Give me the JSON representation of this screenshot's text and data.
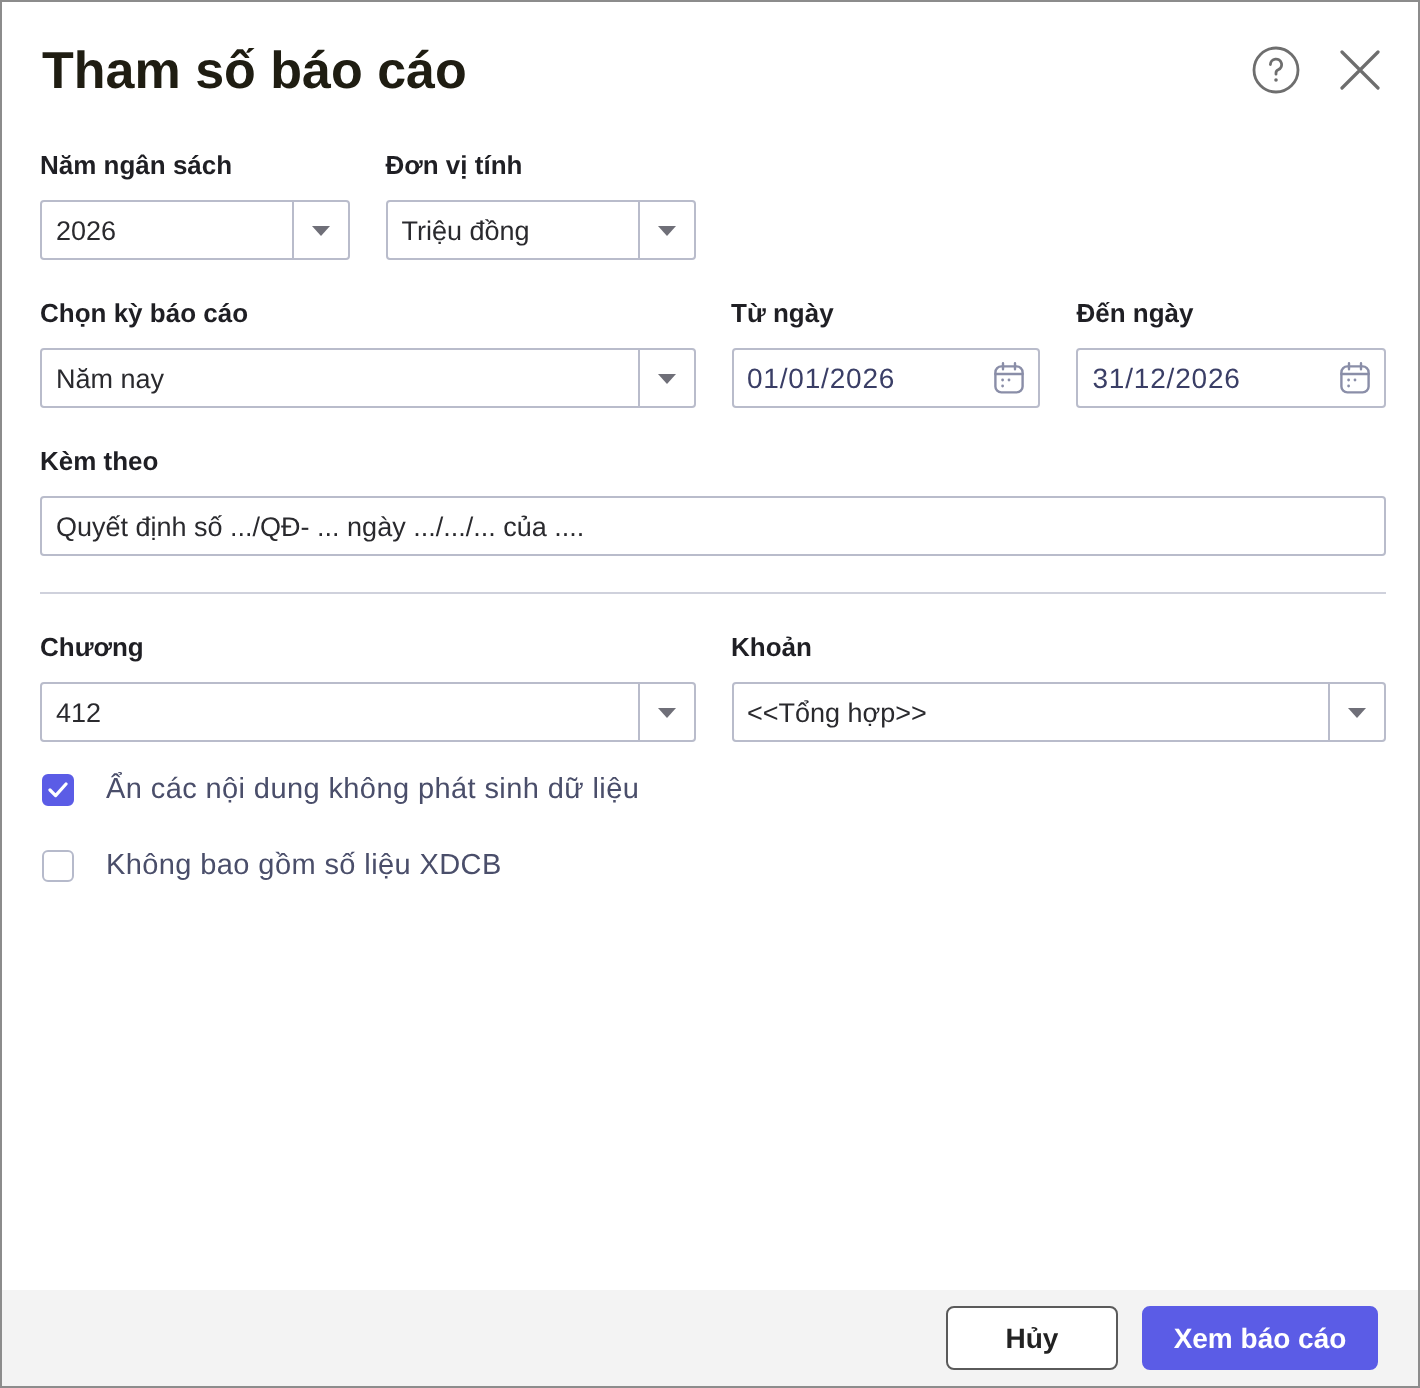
{
  "dialog": {
    "title": "Tham số báo cáo"
  },
  "form": {
    "sections": [
      {
        "rows": [
          [
            {
              "kind": "select",
              "label": "Năm ngân sách",
              "value": "2026"
            },
            {
              "kind": "select",
              "label": "Đơn vị tính",
              "value": "Triệu đồng"
            }
          ],
          [
            {
              "kind": "select",
              "label": "Chọn kỳ báo cáo",
              "value": "Năm nay"
            },
            {
              "kind": "date",
              "label": "Từ ngày",
              "value": "01/01/2026"
            },
            {
              "kind": "date",
              "label": "Đến ngày",
              "value": "31/12/2026"
            }
          ],
          [
            {
              "kind": "text",
              "label": "Kèm theo",
              "value": "Quyết định số .../QĐ- ... ngày .../.../... của ...."
            }
          ]
        ]
      },
      {
        "rows": [
          [
            {
              "kind": "select",
              "label": "Chương",
              "value": "412"
            },
            {
              "kind": "select",
              "label": "Khoản",
              "value": "<<Tổng hợp>>"
            }
          ]
        ]
      }
    ]
  },
  "options": [
    {
      "label": "Ẩn các nội dung không phát sinh dữ liệu",
      "checked": true
    },
    {
      "label": "Không bao gồm số liệu XDCB",
      "checked": false
    }
  ],
  "footer": {
    "buttons": [
      {
        "kind": "secondary",
        "label": "Hủy"
      },
      {
        "kind": "primary",
        "label": "Xem báo cáo"
      }
    ]
  }
}
